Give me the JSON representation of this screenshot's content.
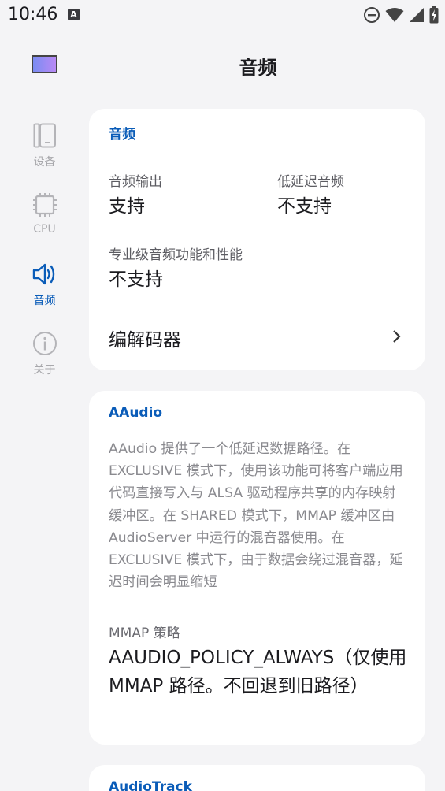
{
  "status_bar": {
    "time": "10:46",
    "notification_letter": "A",
    "icons": [
      "dnd-icon",
      "wifi-icon",
      "signal-icon",
      "battery-charging-icon"
    ]
  },
  "header": {
    "title": "音频"
  },
  "nav": {
    "items": [
      {
        "label": "设备",
        "icon": "device-icon",
        "active": false
      },
      {
        "label": "CPU",
        "icon": "cpu-icon",
        "active": false
      },
      {
        "label": "音频",
        "icon": "speaker-icon",
        "active": true
      },
      {
        "label": "关于",
        "icon": "info-icon",
        "active": false
      }
    ]
  },
  "audio_card": {
    "title": "音频",
    "audio_output_label": "音频输出",
    "audio_output_value": "支持",
    "low_latency_label": "低延迟音频",
    "low_latency_value": "不支持",
    "pro_audio_label": "专业级音频功能和性能",
    "pro_audio_value": "不支持",
    "codecs_label": "编解码器"
  },
  "aaudio_card": {
    "title": "AAudio",
    "description": "AAudio 提供了一个低延迟数据路径。在 EXCLUSIVE 模式下，使用该功能可将客户端应用代码直接写入与 ALSA 驱动程序共享的内存映射缓冲区。在 SHARED 模式下，MMAP 缓冲区由 AudioServer 中运行的混音器使用。在 EXCLUSIVE 模式下，由于数据会绕过混音器，延迟时间会明显缩短",
    "mmap_policy_label": "MMAP 策略",
    "mmap_policy_value": "AAUDIO_POLICY_ALWAYS（仅使用 MMAP 路径。不回退到旧路径）"
  },
  "audiotrack_card": {
    "title": "AudioTrack"
  },
  "colors": {
    "accent": "#0a5cb8",
    "background": "#f4f4f6",
    "card": "#ffffff",
    "muted_text": "#8a8a8f"
  }
}
